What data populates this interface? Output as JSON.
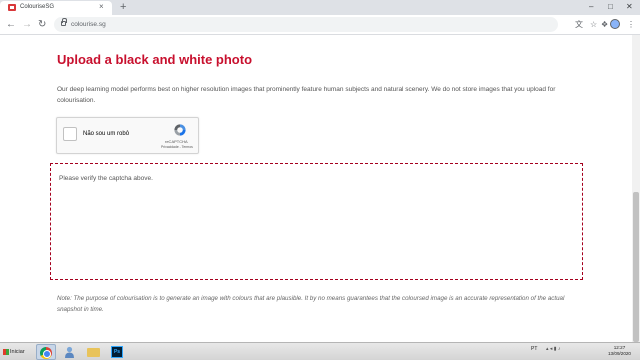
{
  "browser": {
    "tab_title": "ColouriseSG",
    "tab_close": "×",
    "new_tab": "+",
    "window_controls": [
      "–",
      "□",
      "✕"
    ],
    "nav": {
      "back": "←",
      "forward": "→",
      "reload": "↻"
    },
    "url": "colourise.sg",
    "toolbar_icons": [
      "translate-icon",
      "star-icon",
      "extensions-icon",
      "account-icon",
      "menu-icon"
    ],
    "toolbar_glyphs": {
      "translate": "文",
      "star": "☆",
      "extensions": "❖",
      "menu": "⋮"
    }
  },
  "page": {
    "heading": "Upload a black and white photo",
    "intro": "Our deep learning model performs best on higher resolution images that prominently feature human subjects and natural scenery. We do not store images that you upload for colourisation.",
    "captcha": {
      "label": "Não sou um robô",
      "brand": "reCAPTCHA",
      "links": "Privacidade - Termos"
    },
    "dropzone_message": "Please verify the captcha above.",
    "note": "Note: The purpose of colourisation is to generate an image with colours that are plausible. It by no means guarantees that the coloursed image is an accurate representation of the actual snapshot in time."
  },
  "taskbar": {
    "start_label": "Iniciar",
    "apps": [
      "chrome-icon",
      "user-icon",
      "folder-icon",
      "photoshop-icon"
    ],
    "photoshop_label": "Ps",
    "language": "PT",
    "time": "12:27",
    "date": "13/09/2020"
  },
  "colors": {
    "accent": "#c8102e",
    "dropzone_border": "#a5001e",
    "text": "#555555"
  }
}
